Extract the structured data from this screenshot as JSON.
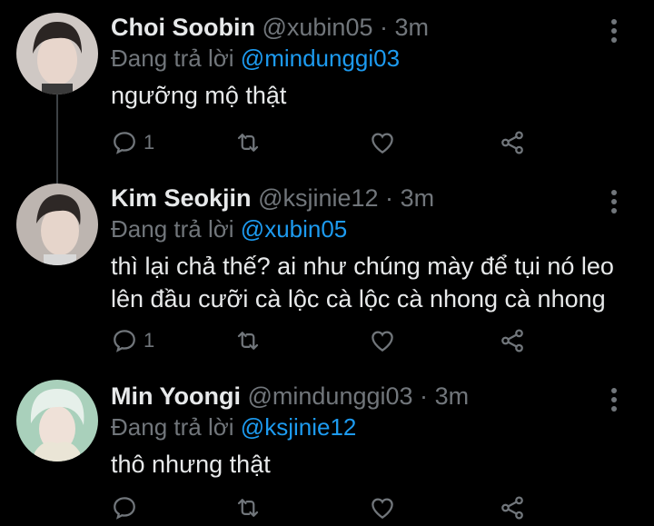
{
  "tweets": [
    {
      "name": "Choi Soobin",
      "handle": "@xubin05",
      "separator": "·",
      "time": "3m",
      "reply_prefix": "Đang trả lời",
      "reply_to": "@mindunggi03",
      "text": "ngưỡng mộ thật",
      "reply_count": "1",
      "avatar_bg": "#c9c3bf"
    },
    {
      "name": "Kim Seokjin",
      "handle": "@ksjinie12",
      "separator": "·",
      "time": "3m",
      "reply_prefix": "Đang trả lời",
      "reply_to": "@xubin05",
      "text": "thì lại chả thế? ai như chúng mày để tụi nó leo lên đầu cưỡi cà lộc cà lộc cà nhong cà nhong",
      "reply_count": "1",
      "avatar_bg": "#b9b1ac"
    },
    {
      "name": "Min Yoongi",
      "handle": "@mindunggi03",
      "separator": "·",
      "time": "3m",
      "reply_prefix": "Đang trả lời",
      "reply_to": "@ksjinie12",
      "text": "thô nhưng thật",
      "reply_count": "",
      "avatar_bg": "#b8d8c6"
    }
  ],
  "colors": {
    "background": "#000000",
    "primary_text": "#e7e9ea",
    "secondary_text": "#71767b",
    "mention": "#1d9bf0",
    "thread_line": "#3d4145"
  },
  "icons": [
    "reply-icon",
    "retweet-icon",
    "like-icon",
    "share-icon",
    "more-icon"
  ]
}
